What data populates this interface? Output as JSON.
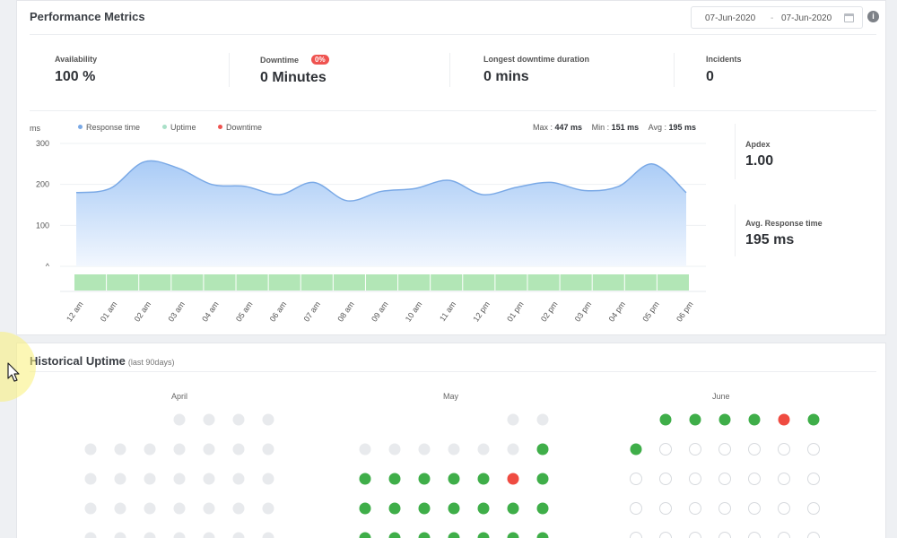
{
  "performance": {
    "title": "Performance Metrics",
    "date_from": "07-Jun-2020",
    "date_sep": "-",
    "date_to": "07-Jun-2020",
    "info_icon": "i",
    "metrics": {
      "availability": {
        "label": "Availability",
        "value": "100 %"
      },
      "downtime": {
        "label": "Downtime",
        "badge": "0%",
        "value": "0 Minutes"
      },
      "longest": {
        "label": "Longest downtime duration",
        "value": "0 mins"
      },
      "incidents": {
        "label": "Incidents",
        "value": "0"
      }
    },
    "legend": {
      "response": "Response time",
      "uptime": "Uptime",
      "downtime": "Downtime"
    },
    "stats": {
      "max_label": "Max :",
      "max_value": "447 ms",
      "min_label": "Min :",
      "min_value": "151 ms",
      "avg_label": "Avg :",
      "avg_value": "195 ms"
    },
    "side": {
      "apdex_label": "Apdex",
      "apdex_value": "1.00",
      "avg_label": "Avg. Response time",
      "avg_value": "195 ms"
    }
  },
  "colors": {
    "response": "#7aa9e6",
    "uptime_bar": "#b2e6b6",
    "legend_uptime": "#a9e0c8",
    "downtime": "#ef5350",
    "green_dot": "#3fae49",
    "red_dot": "#ef4b41",
    "empty_dot": "#e8eaed"
  },
  "chart_data": {
    "type": "area",
    "ylabel": "ms",
    "y_ticks": [
      "300",
      "200",
      "100",
      "^"
    ],
    "ylim": [
      0,
      300
    ],
    "x": [
      "12 am",
      "01 am",
      "02 am",
      "03 am",
      "04 am",
      "05 am",
      "06 am",
      "07 am",
      "08 am",
      "09 am",
      "10 am",
      "11 am",
      "12 pm",
      "01 pm",
      "02 pm",
      "03 pm",
      "04 pm",
      "05 pm",
      "06 pm"
    ],
    "series": [
      {
        "name": "Response time",
        "values": [
          180,
          190,
          255,
          240,
          200,
          195,
          175,
          205,
          160,
          183,
          190,
          210,
          175,
          193,
          205,
          185,
          195,
          250,
          180
        ]
      }
    ],
    "uptime_segments": 19,
    "grid": true
  },
  "historical": {
    "title": "Historical Uptime",
    "subtitle": "(last 90days)",
    "months": [
      {
        "name": "April",
        "rows": [
          [
            0,
            0,
            0,
            0,
            0,
            0,
            0
          ],
          [
            0,
            0,
            0,
            0,
            0,
            0,
            0
          ],
          [
            0,
            0,
            0,
            0,
            0,
            0,
            0
          ],
          [
            0,
            0,
            0,
            0,
            0,
            0,
            0
          ],
          [
            0,
            0,
            0,
            0,
            0,
            0,
            0
          ]
        ]
      },
      {
        "name": "May",
        "rows": [
          [
            0,
            0,
            0,
            0,
            0,
            0,
            0
          ],
          [
            0,
            0,
            0,
            0,
            0,
            0,
            0
          ],
          [
            0,
            0,
            0,
            0,
            0,
            0,
            0
          ],
          [
            0,
            0,
            0,
            0,
            0,
            0,
            0
          ],
          [
            0,
            0,
            0,
            0,
            0,
            0,
            0
          ]
        ]
      },
      {
        "name": "June",
        "rows": [
          [
            0,
            0,
            0,
            0,
            0,
            0,
            0
          ],
          [
            0,
            0,
            0,
            0,
            0,
            0,
            0
          ],
          [
            0,
            0,
            0,
            0,
            0,
            0,
            0
          ],
          [
            0,
            0,
            0,
            0,
            0,
            0,
            0
          ],
          [
            0,
            0,
            0,
            0,
            0,
            0,
            0
          ]
        ]
      }
    ],
    "grid_status": {
      "April": [
        [
          "",
          "",
          "",
          "e",
          "e",
          "e",
          "e"
        ],
        [
          "e",
          "e",
          "e",
          "e",
          "e",
          "e",
          "e"
        ],
        [
          "e",
          "e",
          "e",
          "e",
          "e",
          "e",
          "e"
        ],
        [
          "e",
          "e",
          "e",
          "e",
          "e",
          "e",
          "e"
        ],
        [
          "e",
          "e",
          "e",
          "e",
          "e",
          "e",
          "e"
        ]
      ],
      "May": [
        [
          "",
          "",
          "",
          "",
          "",
          "e",
          "e"
        ],
        [
          "e",
          "e",
          "e",
          "e",
          "e",
          "e",
          "g"
        ],
        [
          "g",
          "g",
          "g",
          "g",
          "g",
          "r",
          "g"
        ],
        [
          "g",
          "g",
          "g",
          "g",
          "g",
          "g",
          "g"
        ],
        [
          "g",
          "g",
          "g",
          "g",
          "g",
          "g",
          "g"
        ]
      ],
      "June": [
        [
          "",
          "g",
          "g",
          "g",
          "g",
          "r",
          "g"
        ],
        [
          "g",
          "o",
          "o",
          "o",
          "o",
          "o",
          "o"
        ],
        [
          "o",
          "o",
          "o",
          "o",
          "o",
          "o",
          "o"
        ],
        [
          "o",
          "o",
          "o",
          "o",
          "o",
          "o",
          "o"
        ],
        [
          "o",
          "o",
          "o",
          "o",
          "o",
          "o",
          "o"
        ]
      ]
    }
  }
}
